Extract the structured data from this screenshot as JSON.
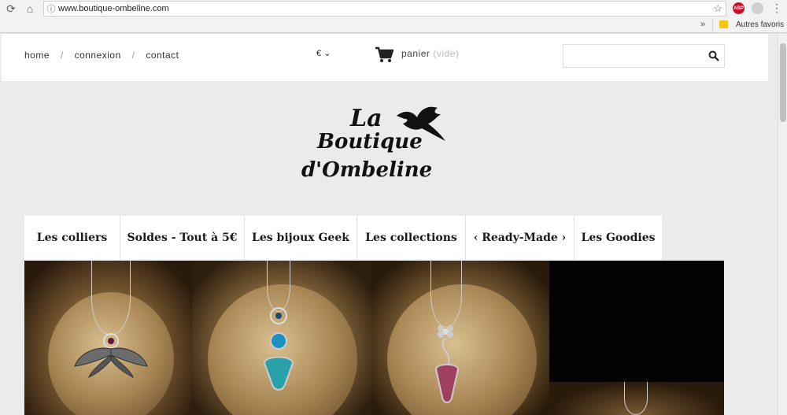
{
  "browser": {
    "url": "www.boutique-ombeline.com",
    "bookmarks_folder": "Autres favoris",
    "extension_abp": "ABP"
  },
  "header": {
    "links": [
      "home",
      "connexion",
      "contact"
    ],
    "separator": "/",
    "currency": "€ ⌄",
    "cart_label": "panier",
    "cart_status": "(vide)",
    "search_placeholder": ""
  },
  "logo": {
    "line1": "La",
    "line2": "Boutique",
    "line3": "d'Ombeline"
  },
  "menu": {
    "items": [
      "Les colliers",
      "Soldes - Tout à 5€",
      "Les bijoux Geek",
      "Les collections",
      "‹ Ready-Made ›",
      "Les Goodies"
    ]
  },
  "colors": {
    "chrome": "#f2f2f2",
    "page_bg": "#ebebeb",
    "banner_bg": "#0a0806"
  }
}
